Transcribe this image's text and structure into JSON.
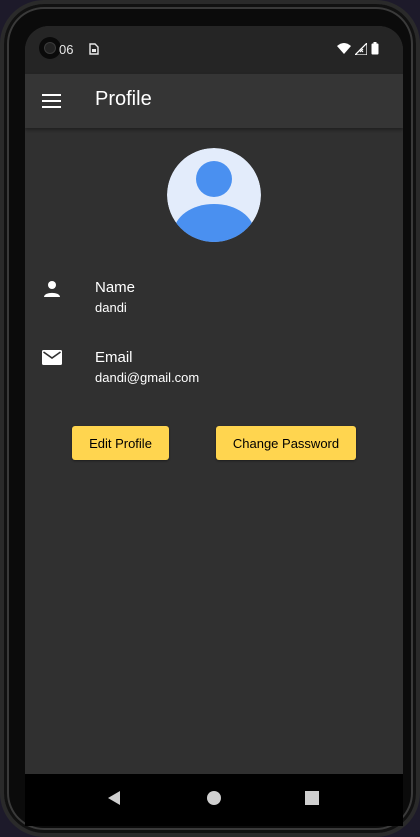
{
  "status_bar": {
    "time": "06",
    "left_icons": [
      "sim-card-icon"
    ],
    "right_icons": [
      "wifi-icon",
      "signal-icon",
      "battery-icon"
    ]
  },
  "app_bar": {
    "menu_icon": "menu-icon",
    "title": "Profile"
  },
  "profile": {
    "avatar_icon": "default-avatar-icon",
    "fields": [
      {
        "icon": "person-icon",
        "label": "Name",
        "value": "dandi"
      },
      {
        "icon": "mail-icon",
        "label": "Email",
        "value": "dandi@gmail.com"
      }
    ]
  },
  "actions": {
    "edit_label": "Edit Profile",
    "change_password_label": "Change Password"
  },
  "nav_bar": {
    "buttons": [
      "back-icon",
      "home-icon",
      "recents-icon"
    ]
  },
  "colors": {
    "background": "#303030",
    "app_bar": "#353535",
    "button": "#ffd54f",
    "avatar_bg": "#e3ecfb",
    "avatar_fg": "#4a90f0"
  }
}
